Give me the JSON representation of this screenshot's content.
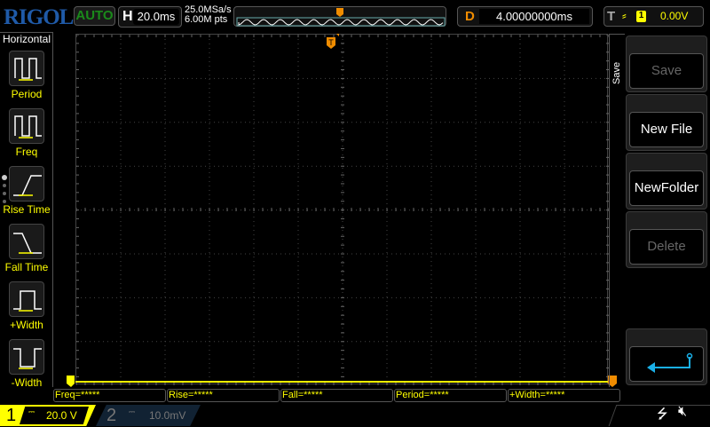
{
  "header": {
    "logo": "RIGOL",
    "mode": "AUTO",
    "h_label": "H",
    "timebase": "20.0ms",
    "sample_rate": "25.0MSa/s",
    "memory_depth": "6.00M pts",
    "delay_label": "D",
    "delay": "4.00000000ms",
    "trig_label": "T",
    "trig_channel": "1",
    "trig_level": "0.00V"
  },
  "sidebar": {
    "title": "Horizontal",
    "items": [
      {
        "label": "Period"
      },
      {
        "label": "Freq"
      },
      {
        "label": "Rise Time"
      },
      {
        "label": "Fall Time"
      },
      {
        "label": "+Width"
      },
      {
        "label": "-Width"
      }
    ]
  },
  "softkeys": {
    "menu_title": "Save",
    "buttons": [
      {
        "label": "Save",
        "enabled": false
      },
      {
        "label": "New File",
        "enabled": true
      },
      {
        "label": "NewFolder",
        "enabled": true
      },
      {
        "label": "Delete",
        "enabled": false
      }
    ],
    "back": "return-icon"
  },
  "measurements": [
    "Freq=*****",
    "Rise=*****",
    "Fall=*****",
    "Period=*****",
    "+Width=*****"
  ],
  "channels": [
    {
      "num": "1",
      "coupling": "DC",
      "scale": "20.0 V",
      "color": "#ffff00"
    },
    {
      "num": "2",
      "coupling": "DC",
      "scale": "10.0mV",
      "color": "#777777"
    }
  ],
  "colors": {
    "ch1": "#ffff00",
    "trigger": "#f08c00",
    "accent": "#1ab0e8"
  }
}
